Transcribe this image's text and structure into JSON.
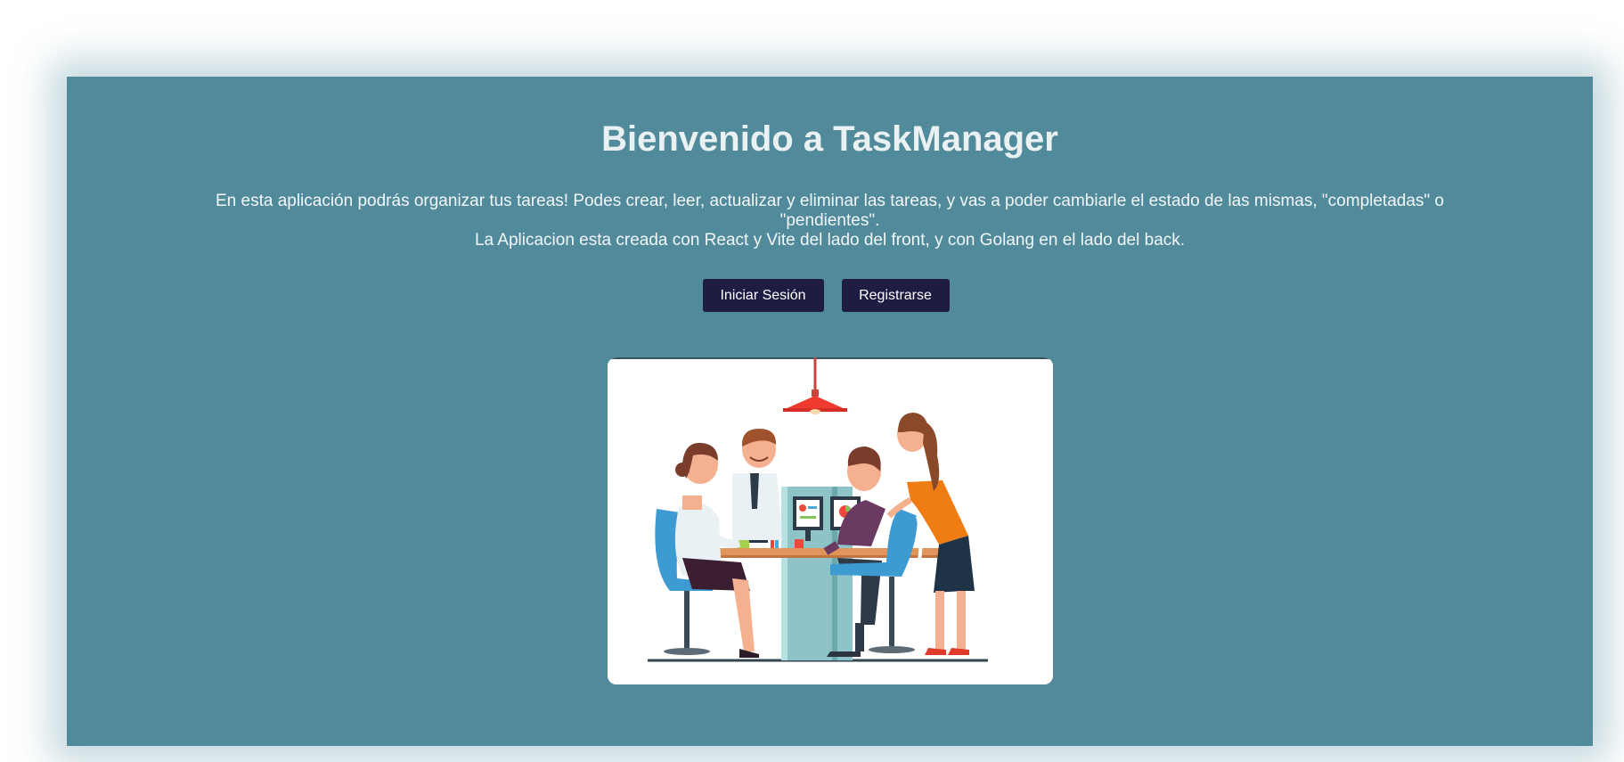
{
  "hero": {
    "title": "Bienvenido a TaskManager",
    "description_line1": "En esta aplicación podrás organizar tus tareas! Podes crear, leer, actualizar y eliminar las tareas, y vas a poder cambiarle el estado de las mismas, \"completadas\" o \"pendientes\".",
    "description_line2": "La Aplicacion esta creada con React y Vite del lado del front, y con Golang en el lado del back."
  },
  "actions": {
    "login_label": "Iniciar Sesión",
    "register_label": "Registrarse"
  },
  "illustration": {
    "icon": "team-meeting-illustration"
  },
  "colors": {
    "page_background": "#ffffff",
    "hero_background": "#518b9b",
    "button_background": "#1f1c44",
    "button_text": "#ffffff",
    "title_text": "#eaf1f3"
  }
}
